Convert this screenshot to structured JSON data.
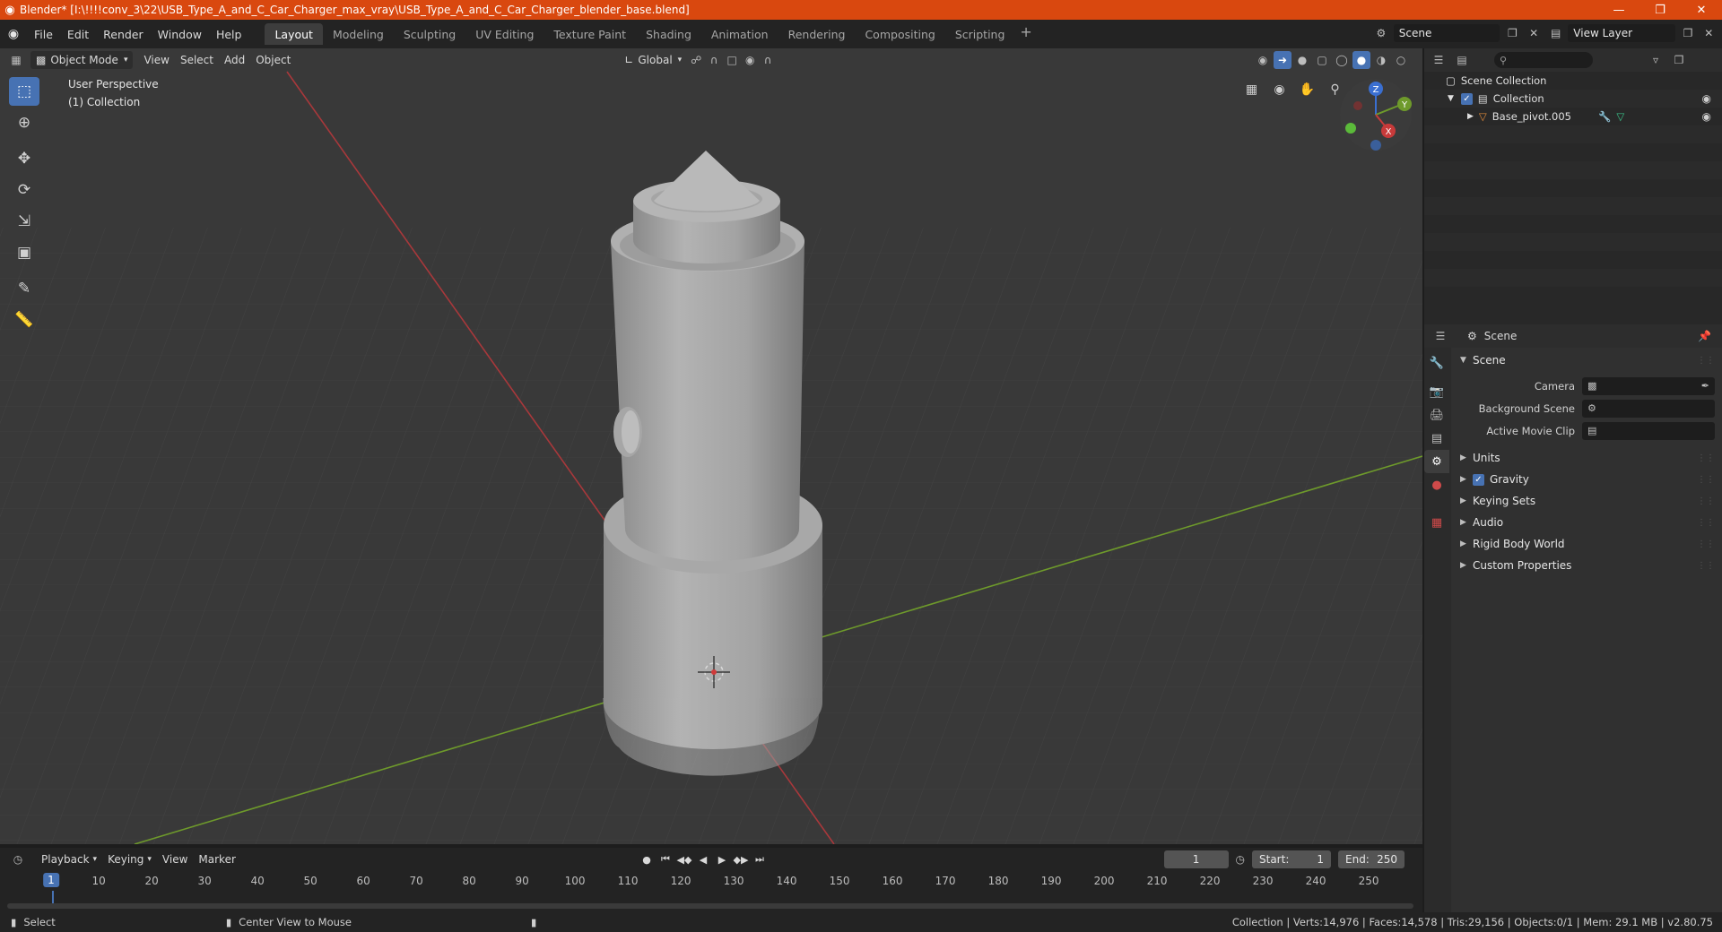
{
  "window": {
    "title": "Blender* [I:\\!!!!conv_3\\22\\USB_Type_A_and_C_Car_Charger_max_vray\\USB_Type_A_and_C_Car_Charger_blender_base.blend]",
    "minimize": "—",
    "restore": "❐",
    "close": "✕"
  },
  "menubar": {
    "items": [
      "File",
      "Edit",
      "Render",
      "Window",
      "Help"
    ],
    "workspaces": [
      "Layout",
      "Modeling",
      "Sculpting",
      "UV Editing",
      "Texture Paint",
      "Shading",
      "Animation",
      "Rendering",
      "Compositing",
      "Scripting"
    ],
    "active_workspace": "Layout",
    "add_tab": "+",
    "scene": "Scene",
    "view_layer": "View Layer"
  },
  "viewport": {
    "mode": "Object Mode",
    "menus": [
      "View",
      "Select",
      "Add",
      "Object"
    ],
    "transform": "Global",
    "perspective": "User Perspective",
    "collection": "(1) Collection",
    "gizmo": {
      "x": "X",
      "y": "Y",
      "z": "Z"
    }
  },
  "timeline": {
    "menus": [
      "Playback",
      "Keying",
      "View",
      "Marker"
    ],
    "current_frame": "1",
    "start_label": "Start:",
    "start": "1",
    "end_label": "End:",
    "end": "250",
    "ticks": [
      "10",
      "20",
      "30",
      "40",
      "50",
      "60",
      "70",
      "80",
      "90",
      "100",
      "110",
      "120",
      "130",
      "140",
      "150",
      "160",
      "170",
      "180",
      "190",
      "200",
      "210",
      "220",
      "230",
      "240",
      "250"
    ],
    "cursor_label": "1"
  },
  "statusbar": {
    "select": "Select",
    "center": "Center View to Mouse",
    "stats": "Collection | Verts:14,976 | Faces:14,578 | Tris:29,156 | Objects:0/1 | Mem: 29.1 MB | v2.80.75"
  },
  "outliner": {
    "search_placeholder": "",
    "scene_collection": "Scene Collection",
    "collection": "Collection",
    "object": "Base_pivot.005"
  },
  "properties": {
    "context": "Scene",
    "section": "Scene",
    "camera_label": "Camera",
    "bg_scene_label": "Background Scene",
    "movie_clip_label": "Active Movie Clip",
    "subsections": [
      "Units",
      "Gravity",
      "Keying Sets",
      "Audio",
      "Rigid Body World",
      "Custom Properties"
    ]
  },
  "colors": {
    "accent": "#4772b3",
    "titlebar": "#d9480f",
    "x_axis": "#c73a3a",
    "y_axis": "#6e9a2b",
    "z_axis": "#3a6fd1"
  }
}
